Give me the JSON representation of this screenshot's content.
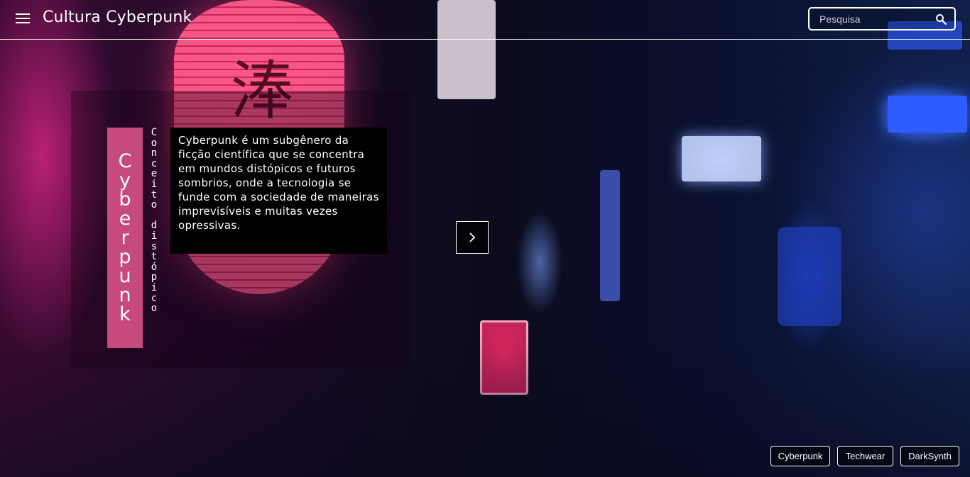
{
  "header": {
    "site_title": "Cultura Cyberpunk",
    "menu_icon": "hamburger-menu-icon",
    "search": {
      "placeholder": "Pesquisa",
      "value": "",
      "icon": "search-icon"
    }
  },
  "hero": {
    "title": "Cyberpunk",
    "subtitle_lines": [
      "Conceito",
      "distópico"
    ],
    "description": "Cyberpunk é um subgênero da ficção científica que se concentra em mundos distópicos e futuros sombrios, onde a tecnologia se funde com a sociedade de maneiras imprevisíveis e muitas vezes opressivas.",
    "next_icon": "chevron-right-icon",
    "title_color": "#c74a7e"
  },
  "tags": [
    "Cyberpunk",
    "Techwear",
    "DarkSynth"
  ]
}
